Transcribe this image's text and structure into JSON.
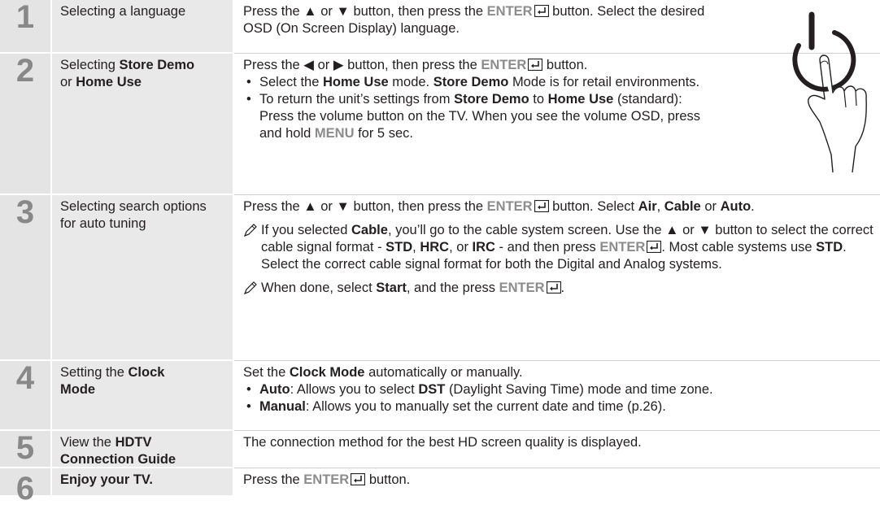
{
  "steps": [
    {
      "num": "1",
      "title": "Selecting a language"
    },
    {
      "num": "2",
      "title_a": "Selecting ",
      "title_b": "Store Demo",
      "title_c": "or ",
      "title_d": "Home Use"
    },
    {
      "num": "3",
      "title": "Selecting search options for auto tuning"
    },
    {
      "num": "4",
      "title_a": "Setting the ",
      "title_b": "Clock Mode"
    },
    {
      "num": "5",
      "title_a": "View the ",
      "title_b": "HDTV Connection Guide"
    },
    {
      "num": "6",
      "title": "Enjoy your TV."
    }
  ],
  "text": {
    "press_the": "Press the",
    "up": "▲",
    "or": "or",
    "down": "▼",
    "left": "◀",
    "right": "▶",
    "button_then_press_the": "button, then press the",
    "enter": "ENTER",
    "button": "button.",
    "s1_select": "Select the desired OSD (On Screen Display) language.",
    "s2_b1_a": "Select the",
    "home_use": "Home Use",
    "s2_b1_b": "mode.",
    "store_demo": "Store Demo",
    "s2_b1_c": "Mode is for retail environments.",
    "s2_b2_a": "To return the unit’s settings from",
    "to": "to",
    "s2_b2_b": "(standard): Press the volume button on the TV. When you see the volume OSD, press and hold",
    "menu": "MENU",
    "s2_b2_c": "for 5 sec.",
    "s3_select": "Select",
    "air": "Air",
    "cable": "Cable",
    "auto": "Auto",
    "s3_n1_a": "If you selected",
    "s3_n1_b": ", you’ll go to the cable system screen. Use the",
    "s3_n1_c": "button to select the correct cable signal format -",
    "std": "STD",
    "hrc": "HRC",
    "irc": "IRC",
    "s3_n1_d": "- and then press",
    "s3_n1_e": ". Most cable systems use",
    "s3_n1_f": ". Select the correct cable signal format for both the Digital and Analog systems.",
    "s3_n2_a": "When done, select",
    "start": "Start",
    "s3_n2_b": ", and the press",
    "s4_a": "Set the",
    "clock_mode": "Clock Mode",
    "s4_b": "automatically or manually.",
    "auto_label": "Auto",
    "s4_auto": ": Allows you to select",
    "dst": "DST",
    "s4_auto_b": "(Daylight Saving Time) mode and time zone.",
    "manual": "Manual",
    "s4_manual": ": Allows you to manually set the current date and time (p.26).",
    "s5": "The connection method for the best HD screen quality is displayed.",
    "s6": "Press the"
  }
}
